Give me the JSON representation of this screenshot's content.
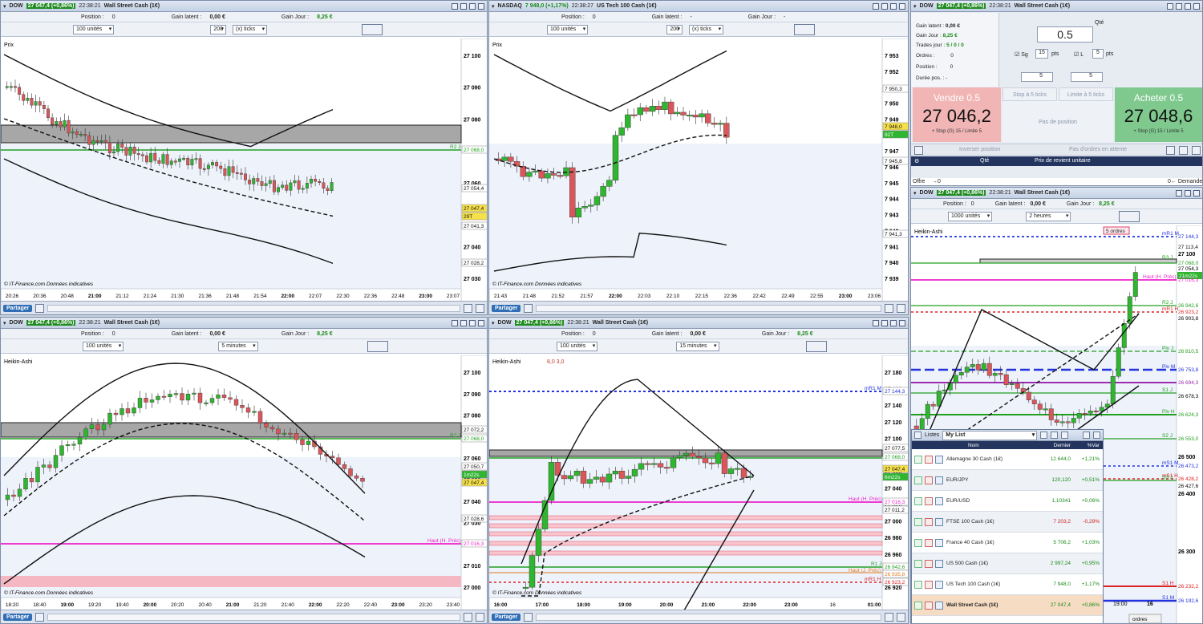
{
  "windows": {
    "tl": {
      "symbol": "DOW",
      "price_change": "27 047,4 (+0,86%)",
      "time": "22:38:21",
      "name": "Wall Street Cash (1€)",
      "position_label": "Position :",
      "position_value": "0",
      "gain_latent_label": "Gain latent :",
      "gain_latent_value": "0,00 €",
      "gain_jour_label": "Gain Jour :",
      "gain_jour_value": "8,25 €",
      "qty": "100 unités",
      "ticks": "200",
      "unit": "(x) ticks",
      "chart_label": "Prix",
      "credit": "© IT-Finance.com  Données indicatives",
      "price_ticks": [
        "27 100",
        "27 090",
        "27 080",
        "27 070",
        "27 060",
        "27 050",
        "27 040",
        "27 030"
      ],
      "time_ticks": [
        "20:26",
        "20:36",
        "20:48",
        "21:00",
        "21:12",
        "21:24",
        "21:30",
        "21:36",
        "21:48",
        "21:54",
        "22:00",
        "22:07",
        "22:30",
        "22:36",
        "22:48",
        "23:00",
        "23:07"
      ],
      "tags": {
        "r2": "R2 J",
        "l1": "27 068,0",
        "l2": "27 054,4",
        "l3": "27 047,4",
        "l4": "29T",
        "l5": "27 041,3",
        "l6": "27 028,2"
      }
    },
    "tm": {
      "symbol": "NASDAQ",
      "price_change": "7 948,0 (+1,17%)",
      "time": "22:38:27",
      "name": "US Tech 100 Cash (1€)",
      "position_label": "Position :",
      "position_value": "0",
      "gain_latent_label": "Gain latent :",
      "gain_latent_value": "-",
      "gain_jour_label": "Gain Jour :",
      "gain_jour_value": "-",
      "qty": "100 unités",
      "ticks": "200",
      "unit": "(x) ticks",
      "chart_label": "Prix",
      "credit": "© IT-Finance.com  Données indicatives",
      "price_ticks": [
        "7 953",
        "7 952",
        "7 951",
        "7 950",
        "7 949",
        "7 948",
        "7 947",
        "7 946",
        "7 945",
        "7 944",
        "7 943",
        "7 942",
        "7 941",
        "7 940",
        "7 939"
      ],
      "time_ticks": [
        "21:43",
        "21:48",
        "21:52",
        "21:57",
        "22:00",
        "22:03",
        "22:10",
        "22:15",
        "22:36",
        "22:42",
        "22:49",
        "22:55",
        "23:00",
        "23:06"
      ],
      "tags": {
        "l1": "7 950,3",
        "l2": "7 948,0",
        "l3": "92T",
        "l4": "7 945,8",
        "l5": "7 941,3"
      }
    },
    "bl": {
      "symbol": "DOW",
      "price_change": "27 047,4 (+0,86%)",
      "time": "22:38:21",
      "name": "Wall Street Cash (1€)",
      "position_label": "Position :",
      "position_value": "0",
      "gain_latent_label": "Gain latent :",
      "gain_latent_value": "0,00 €",
      "gain_jour_label": "Gain Jour :",
      "gain_jour_value": "8,25 €",
      "qty": "100 unités",
      "period": "5 minutes",
      "chart_label": "Heikin-Ashi",
      "credit": "© IT-Finance.com  Données indicatives",
      "price_ticks": [
        "27 100",
        "27 090",
        "27 080",
        "27 070",
        "27 060",
        "27 050",
        "27 040",
        "27 030",
        "27 020",
        "27 010",
        "27 000"
      ],
      "time_ticks": [
        "18:20",
        "18:40",
        "19:00",
        "19:20",
        "19:40",
        "20:00",
        "20:20",
        "20:40",
        "21:00",
        "21:20",
        "21:40",
        "22:00",
        "22:20",
        "22:40",
        "23:00",
        "23:20",
        "23:40"
      ],
      "tags": {
        "r2": "R2 J",
        "haut": "Haut (H. Préc)",
        "l1": "27 072,2",
        "l2": "27 068,0",
        "l3": "27 050,7",
        "l4": "1m22s",
        "l5": "27 047,4",
        "l6": "27 028,6",
        "l7": "27 016,3"
      }
    },
    "bm": {
      "symbol": "DOW",
      "price_change": "27 047,4 (+0,86%)",
      "time": "22:38:21",
      "name": "Wall Street Cash (1€)",
      "position_label": "Position :",
      "position_value": "0",
      "gain_latent_label": "Gain latent :",
      "gain_latent_value": "0,00 €",
      "gain_jour_label": "Gain Jour :",
      "gain_jour_value": "8,25 €",
      "qty": "100 unités",
      "period": "15 minutes",
      "chart_label": "Heikin-Ashi",
      "credit": "© IT-Finance.com  Données indicatives",
      "price_ticks": [
        "27 180",
        "27 160",
        "27 140",
        "27 120",
        "27 100",
        "27 080",
        "27 060",
        "27 040",
        "27 020",
        "27 000",
        "26 980",
        "26 960",
        "26 940",
        "26 920"
      ],
      "time_ticks": [
        "16:00",
        "17:00",
        "18:00",
        "19:00",
        "20:00",
        "21:00",
        "22:00",
        "23:00",
        "16",
        "01:00"
      ],
      "ind": "8,0 3,0",
      "tags": {
        "mr1": "mR1 M",
        "l0": "27 144,3",
        "l1": "27 077,5",
        "l2": "27 068,0",
        "l3": "27 047,4",
        "l4": "6m22s",
        "haut": "Haut (H. Préc)",
        "l5": "27 016,3",
        "l6": "27 011,2",
        "r1": "R1 J",
        "hautj": "Haut (J. Préc)",
        "l7": "26 942,6",
        "l8": "26 935,8",
        "mr1b": "mR1 H",
        "l9": "26 923,2"
      }
    }
  },
  "right": {
    "symbol": "DOW",
    "price_change": "27 047,4 (+0,86%)",
    "time": "22:38:21",
    "name": "Wall Street Cash (1€)",
    "gain_latent_label": "Gain latent :",
    "gain_latent_value": "0,00 €",
    "gain_jour_label": "Gain Jour :",
    "gain_jour_value": "8,25 €",
    "trades_label": "Trades jour :",
    "trades_value": "5 / 0 / 0",
    "ordres_label": "Ordres :",
    "ordres_value": "0",
    "position_label": "Position :",
    "position_value": "0",
    "duree_label": "Durée pos. :",
    "duree_value": "-",
    "qte_label": "Qté",
    "qte_value": "0.5",
    "sg_label": "Sg",
    "sg_value": "15",
    "pts": "pts",
    "l_label": "L",
    "l_value": "5",
    "stepper1": "5",
    "stepper2": "5",
    "sell_label": "Vendre 0.5",
    "sell_price": "27 046,2",
    "sell_sub": "+ Stop (G) 15 / Limite 5",
    "buy_label": "Acheter 0.5",
    "buy_price": "27 048,6",
    "buy_sub": "+ Stop (G) 15 / Limite 5",
    "stop5": "Stop à 5 ticks",
    "limite5": "Limite à 5 ticks",
    "pas_position": "Pas de position",
    "inverser": "Inverser position",
    "pas_ordres": "Pas d'ordres en attente",
    "col_qte": "Qté",
    "col_prix": "Prix de revient unitaire",
    "offre": "Offre",
    "demande": "Demande",
    "zero": "0"
  },
  "chart2h": {
    "symbol": "DOW",
    "price_change": "27 047,4 (+0,86%)",
    "time": "22:38:21",
    "name": "Wall Street Cash (1€)",
    "position_label": "Position :",
    "position_value": "0",
    "gain_latent_label": "Gain latent :",
    "gain_latent_value": "0,00 €",
    "gain_jour_label": "Gain Jour :",
    "gain_jour_value": "8,25 €",
    "qty": "1000 unités",
    "period": "2 heures",
    "chart_label": "Heikin-Ashi",
    "ordres": "5 ordres",
    "tags": {
      "mr1": "mR1 M",
      "r3": "R3 J",
      "haut": "Haut (H. Préc)",
      "r2": "R2 J",
      "r1": "R1 J",
      "mr1h": "mR1 H",
      "piv": "Piv J",
      "pivm": "Piv M",
      "s1": "S1 J",
      "pivh": "Piv H",
      "s2": "S2 J",
      "ms1": "mS1 M",
      "ms1h": "mS1 H",
      "s3": "S3 J",
      "s1h": "S1 H",
      "s1m": "S1 M",
      "p1": "27 144,3",
      "p2": "27 113,4",
      "p3": "27 100",
      "p4": "27 068,0",
      "p5": "27 054,3",
      "p6": "21m22s",
      "p7": "27 016,3",
      "p8": "26 942,6",
      "p9": "26 923,2",
      "p10": "26 903,8",
      "p11": "26 810,5",
      "p12": "26 753,8",
      "p13": "26 694,3",
      "p14": "26 678,3",
      "p15": "26 624,3",
      "p16": "26 553,0",
      "p17": "26 500",
      "p18": "26 473,2",
      "p19": "26 428,2",
      "p20": "26 427,6",
      "p21": "26 400",
      "p22": "26 300",
      "p23": "26 232,2",
      "p24": "26 192,6"
    },
    "time_ticks": [
      "19:00",
      "16"
    ],
    "ordres_tab": "ordres"
  },
  "watchlist": {
    "tab": "Listes",
    "list_name": "My List",
    "headers": {
      "nom": "Nom",
      "dernier": "Dernier",
      "var": "%Var"
    },
    "rows": [
      {
        "nom": "Allemagne 30 Cash (1€)",
        "dernier": "12 644,0",
        "var": "+1,21%"
      },
      {
        "nom": "EUR/JPY",
        "dernier": "120,120",
        "var": "+0,51%"
      },
      {
        "nom": "EUR/USD",
        "dernier": "1,10341",
        "var": "+0,06%"
      },
      {
        "nom": "FTSE 100 Cash (1€)",
        "dernier": "7 203,2",
        "var": "-0,29%"
      },
      {
        "nom": "France 40 Cash (1€)",
        "dernier": "5 706,2",
        "var": "+1,03%"
      },
      {
        "nom": "US 500 Cash (1€)",
        "dernier": "2 997,24",
        "var": "+0,95%"
      },
      {
        "nom": "US Tech 100 Cash (1€)",
        "dernier": "7 948,0",
        "var": "+1,17%"
      },
      {
        "nom": "Wall Street Cash (1€)",
        "dernier": "27 047,4",
        "var": "+0,86%"
      }
    ]
  },
  "share": "Partager",
  "colors": {
    "bull": "#2fb52f",
    "bear": "#d9575a",
    "green_text": "#1a8a1a",
    "sell": "#f1b5b5",
    "buy": "#7fc98e",
    "accent": "#2f6db5"
  }
}
